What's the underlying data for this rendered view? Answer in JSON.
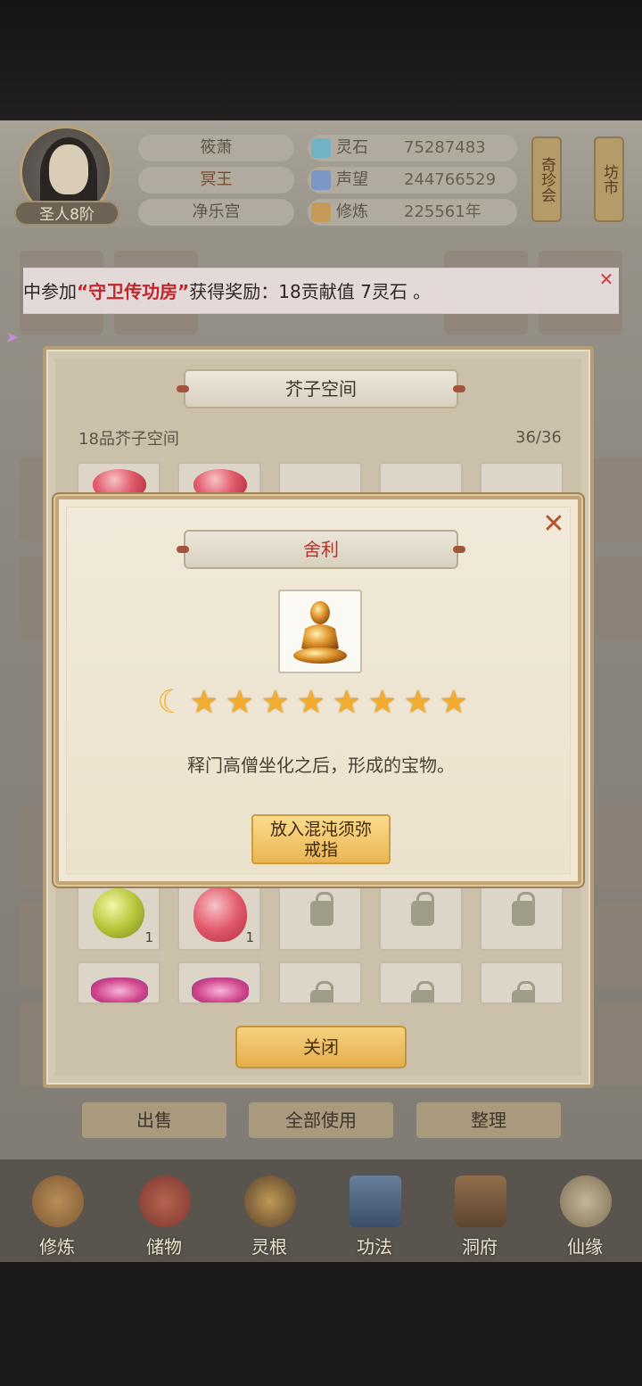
{
  "player": {
    "rank": "圣人8阶",
    "names": [
      "筱萧",
      "冥王",
      "净乐宫"
    ],
    "stats": [
      {
        "icon": "spirit-stone-icon",
        "label": "灵石",
        "value": "75287483"
      },
      {
        "icon": "reputation-icon",
        "label": "声望",
        "value": "244766529"
      },
      {
        "icon": "cultivation-icon",
        "label": "修炼",
        "value": "225561年"
      }
    ]
  },
  "side_buttons": {
    "treasure_fair": "奇珍会",
    "market": "坊市"
  },
  "notice": {
    "prefix": "中参加",
    "highlight": "“守卫传功房”",
    "suffix": "获得奖励：18贡献值 7灵石 。"
  },
  "storage": {
    "title": "芥子空间",
    "subtitle": "18品芥子空间",
    "capacity": "36/36",
    "close_label": "关闭",
    "rows": [
      [
        {
          "type": "orb-green",
          "count": "1"
        },
        {
          "type": "orb-red",
          "count": "1"
        },
        {
          "type": "locked"
        },
        {
          "type": "locked"
        },
        {
          "type": "locked"
        }
      ],
      [
        {
          "type": "orb-dragon"
        },
        {
          "type": "orb-dragon"
        },
        {
          "type": "locked"
        },
        {
          "type": "locked"
        },
        {
          "type": "locked"
        }
      ]
    ]
  },
  "actions": {
    "sell": "出售",
    "use_all": "全部使用",
    "organize": "整理"
  },
  "nav": [
    {
      "label": "修炼",
      "icon": "cultivate-icon"
    },
    {
      "label": "储物",
      "icon": "storage-bag-icon"
    },
    {
      "label": "灵根",
      "icon": "spirit-root-icon"
    },
    {
      "label": "功法",
      "icon": "technique-book-icon"
    },
    {
      "label": "洞府",
      "icon": "cave-dwelling-icon"
    },
    {
      "label": "仙缘",
      "icon": "fortune-icon"
    }
  ],
  "item_modal": {
    "name": "舍利",
    "icon": "sarira-buddha-icon",
    "moon_count": 1,
    "star_count": 8,
    "description": "释门高僧坐化之后，形成的宝物。",
    "action_label": "放入混沌须弥戒指"
  },
  "colors": {
    "title_red": "#b83028",
    "notice_highlight": "#c0262c",
    "star": "#f2ae2b",
    "button_gold": "#eab552"
  }
}
